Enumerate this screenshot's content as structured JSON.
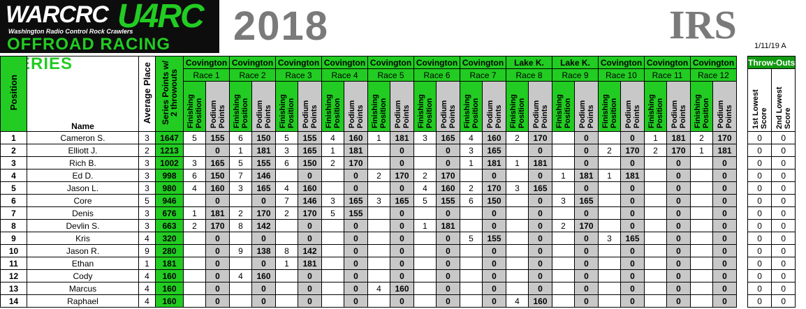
{
  "header": {
    "logo_primary": "WARCRC",
    "logo_secondary": "U4RC",
    "logo_tagline": "Washington Radio Control Rock Crawlers",
    "logo_series": "OFFROAD RACING SERIES",
    "year": "2018",
    "class": "IRS",
    "updated": "1/11/19 A"
  },
  "columns": {
    "position": "Position",
    "name": "Name",
    "avg_place": "Average Place",
    "series_points": "Series Points w/ 2 throwouts",
    "finishing": "Finishing Position",
    "podium": "Podium Points",
    "throwouts_title": "Throw-Outs",
    "lowest1": "1st Lowest Score",
    "lowest2": "2nd Lowest Score"
  },
  "races": [
    {
      "location": "Covington",
      "label": "Race 1"
    },
    {
      "location": "Covington",
      "label": "Race 2"
    },
    {
      "location": "Covington",
      "label": "Race 3"
    },
    {
      "location": "Covington",
      "label": "Race 4"
    },
    {
      "location": "Covington",
      "label": "Race 5"
    },
    {
      "location": "Covington",
      "label": "Race 6"
    },
    {
      "location": "Covington",
      "label": "Race 7"
    },
    {
      "location": "Lake K.",
      "label": "Race 8"
    },
    {
      "location": "Lake K.",
      "label": "Race 9"
    },
    {
      "location": "Covington",
      "label": "Race 10"
    },
    {
      "location": "Covington",
      "label": "Race 11"
    },
    {
      "location": "Covington",
      "label": "Race 12"
    }
  ],
  "rows": [
    {
      "pos": "1",
      "name": "Cameron S.",
      "avg": "3",
      "series": "1647",
      "races": [
        [
          "5",
          "155"
        ],
        [
          "6",
          "150"
        ],
        [
          "5",
          "155"
        ],
        [
          "4",
          "160"
        ],
        [
          "1",
          "181"
        ],
        [
          "3",
          "165"
        ],
        [
          "4",
          "160"
        ],
        [
          "2",
          "170"
        ],
        [
          "",
          "0"
        ],
        [
          "",
          "0"
        ],
        [
          "1",
          "181"
        ],
        [
          "2",
          "170"
        ]
      ],
      "low1": "0",
      "low2": "0"
    },
    {
      "pos": "2",
      "name": "Elliott J.",
      "avg": "2",
      "series": "1213",
      "races": [
        [
          "",
          "0"
        ],
        [
          "1",
          "181"
        ],
        [
          "3",
          "165"
        ],
        [
          "1",
          "181"
        ],
        [
          "",
          "0"
        ],
        [
          "",
          "0"
        ],
        [
          "3",
          "165"
        ],
        [
          "",
          "0"
        ],
        [
          "",
          "0"
        ],
        [
          "2",
          "170"
        ],
        [
          "2",
          "170"
        ],
        [
          "1",
          "181"
        ]
      ],
      "low1": "0",
      "low2": "0"
    },
    {
      "pos": "3",
      "name": "Rich B.",
      "avg": "3",
      "series": "1002",
      "races": [
        [
          "3",
          "165"
        ],
        [
          "5",
          "155"
        ],
        [
          "6",
          "150"
        ],
        [
          "2",
          "170"
        ],
        [
          "",
          "0"
        ],
        [
          "",
          "0"
        ],
        [
          "1",
          "181"
        ],
        [
          "1",
          "181"
        ],
        [
          "",
          "0"
        ],
        [
          "",
          "0"
        ],
        [
          "",
          "0"
        ],
        [
          "",
          "0"
        ]
      ],
      "low1": "0",
      "low2": "0"
    },
    {
      "pos": "4",
      "name": "Ed D.",
      "avg": "3",
      "series": "998",
      "races": [
        [
          "6",
          "150"
        ],
        [
          "7",
          "146"
        ],
        [
          "",
          "0"
        ],
        [
          "",
          "0"
        ],
        [
          "2",
          "170"
        ],
        [
          "2",
          "170"
        ],
        [
          "",
          "0"
        ],
        [
          "",
          "0"
        ],
        [
          "1",
          "181"
        ],
        [
          "1",
          "181"
        ],
        [
          "",
          "0"
        ],
        [
          "",
          "0"
        ]
      ],
      "low1": "0",
      "low2": "0"
    },
    {
      "pos": "5",
      "name": "Jason L.",
      "avg": "3",
      "series": "980",
      "races": [
        [
          "4",
          "160"
        ],
        [
          "3",
          "165"
        ],
        [
          "4",
          "160"
        ],
        [
          "",
          "0"
        ],
        [
          "",
          "0"
        ],
        [
          "4",
          "160"
        ],
        [
          "2",
          "170"
        ],
        [
          "3",
          "165"
        ],
        [
          "",
          "0"
        ],
        [
          "",
          "0"
        ],
        [
          "",
          "0"
        ],
        [
          "",
          "0"
        ]
      ],
      "low1": "0",
      "low2": "0"
    },
    {
      "pos": "6",
      "name": "Core",
      "avg": "5",
      "series": "946",
      "races": [
        [
          "",
          "0"
        ],
        [
          "",
          "0"
        ],
        [
          "7",
          "146"
        ],
        [
          "3",
          "165"
        ],
        [
          "3",
          "165"
        ],
        [
          "5",
          "155"
        ],
        [
          "6",
          "150"
        ],
        [
          "",
          "0"
        ],
        [
          "3",
          "165"
        ],
        [
          "",
          "0"
        ],
        [
          "",
          "0"
        ],
        [
          "",
          "0"
        ]
      ],
      "low1": "0",
      "low2": "0"
    },
    {
      "pos": "7",
      "name": "Denis",
      "avg": "3",
      "series": "676",
      "races": [
        [
          "1",
          "181"
        ],
        [
          "2",
          "170"
        ],
        [
          "2",
          "170"
        ],
        [
          "5",
          "155"
        ],
        [
          "",
          "0"
        ],
        [
          "",
          "0"
        ],
        [
          "",
          "0"
        ],
        [
          "",
          "0"
        ],
        [
          "",
          "0"
        ],
        [
          "",
          "0"
        ],
        [
          "",
          "0"
        ],
        [
          "",
          "0"
        ]
      ],
      "low1": "0",
      "low2": "0"
    },
    {
      "pos": "8",
      "name": "Devlin S.",
      "avg": "3",
      "series": "663",
      "races": [
        [
          "2",
          "170"
        ],
        [
          "8",
          "142"
        ],
        [
          "",
          "0"
        ],
        [
          "",
          "0"
        ],
        [
          "",
          "0"
        ],
        [
          "1",
          "181"
        ],
        [
          "",
          "0"
        ],
        [
          "",
          "0"
        ],
        [
          "2",
          "170"
        ],
        [
          "",
          "0"
        ],
        [
          "",
          "0"
        ],
        [
          "",
          "0"
        ]
      ],
      "low1": "0",
      "low2": "0"
    },
    {
      "pos": "9",
      "name": "Kris",
      "avg": "4",
      "series": "320",
      "races": [
        [
          "",
          "0"
        ],
        [
          "",
          "0"
        ],
        [
          "",
          "0"
        ],
        [
          "",
          "0"
        ],
        [
          "",
          "0"
        ],
        [
          "",
          "0"
        ],
        [
          "5",
          "155"
        ],
        [
          "",
          "0"
        ],
        [
          "",
          "0"
        ],
        [
          "3",
          "165"
        ],
        [
          "",
          "0"
        ],
        [
          "",
          "0"
        ]
      ],
      "low1": "0",
      "low2": "0"
    },
    {
      "pos": "10",
      "name": "Jason R.",
      "avg": "9",
      "series": "280",
      "races": [
        [
          "",
          "0"
        ],
        [
          "9",
          "138"
        ],
        [
          "8",
          "142"
        ],
        [
          "",
          "0"
        ],
        [
          "",
          "0"
        ],
        [
          "",
          "0"
        ],
        [
          "",
          "0"
        ],
        [
          "",
          "0"
        ],
        [
          "",
          "0"
        ],
        [
          "",
          "0"
        ],
        [
          "",
          "0"
        ],
        [
          "",
          "0"
        ]
      ],
      "low1": "0",
      "low2": "0"
    },
    {
      "pos": "11",
      "name": "Ethan",
      "avg": "1",
      "series": "181",
      "races": [
        [
          "",
          "0"
        ],
        [
          "",
          "0"
        ],
        [
          "1",
          "181"
        ],
        [
          "",
          "0"
        ],
        [
          "",
          "0"
        ],
        [
          "",
          "0"
        ],
        [
          "",
          "0"
        ],
        [
          "",
          "0"
        ],
        [
          "",
          "0"
        ],
        [
          "",
          "0"
        ],
        [
          "",
          "0"
        ],
        [
          "",
          "0"
        ]
      ],
      "low1": "0",
      "low2": "0"
    },
    {
      "pos": "12",
      "name": "Cody",
      "avg": "4",
      "series": "160",
      "races": [
        [
          "",
          "0"
        ],
        [
          "4",
          "160"
        ],
        [
          "",
          "0"
        ],
        [
          "",
          "0"
        ],
        [
          "",
          "0"
        ],
        [
          "",
          "0"
        ],
        [
          "",
          "0"
        ],
        [
          "",
          "0"
        ],
        [
          "",
          "0"
        ],
        [
          "",
          "0"
        ],
        [
          "",
          "0"
        ],
        [
          "",
          "0"
        ]
      ],
      "low1": "0",
      "low2": "0"
    },
    {
      "pos": "13",
      "name": "Marcus",
      "avg": "4",
      "series": "160",
      "races": [
        [
          "",
          "0"
        ],
        [
          "",
          "0"
        ],
        [
          "",
          "0"
        ],
        [
          "",
          "0"
        ],
        [
          "4",
          "160"
        ],
        [
          "",
          "0"
        ],
        [
          "",
          "0"
        ],
        [
          "",
          "0"
        ],
        [
          "",
          "0"
        ],
        [
          "",
          "0"
        ],
        [
          "",
          "0"
        ],
        [
          "",
          "0"
        ]
      ],
      "low1": "0",
      "low2": "0"
    },
    {
      "pos": "14",
      "name": "Raphael",
      "avg": "4",
      "series": "160",
      "races": [
        [
          "",
          "0"
        ],
        [
          "",
          "0"
        ],
        [
          "",
          "0"
        ],
        [
          "",
          "0"
        ],
        [
          "",
          "0"
        ],
        [
          "",
          "0"
        ],
        [
          "",
          "0"
        ],
        [
          "4",
          "160"
        ],
        [
          "",
          "0"
        ],
        [
          "",
          "0"
        ],
        [
          "",
          "0"
        ],
        [
          "",
          "0"
        ]
      ],
      "low1": "0",
      "low2": "0"
    }
  ]
}
